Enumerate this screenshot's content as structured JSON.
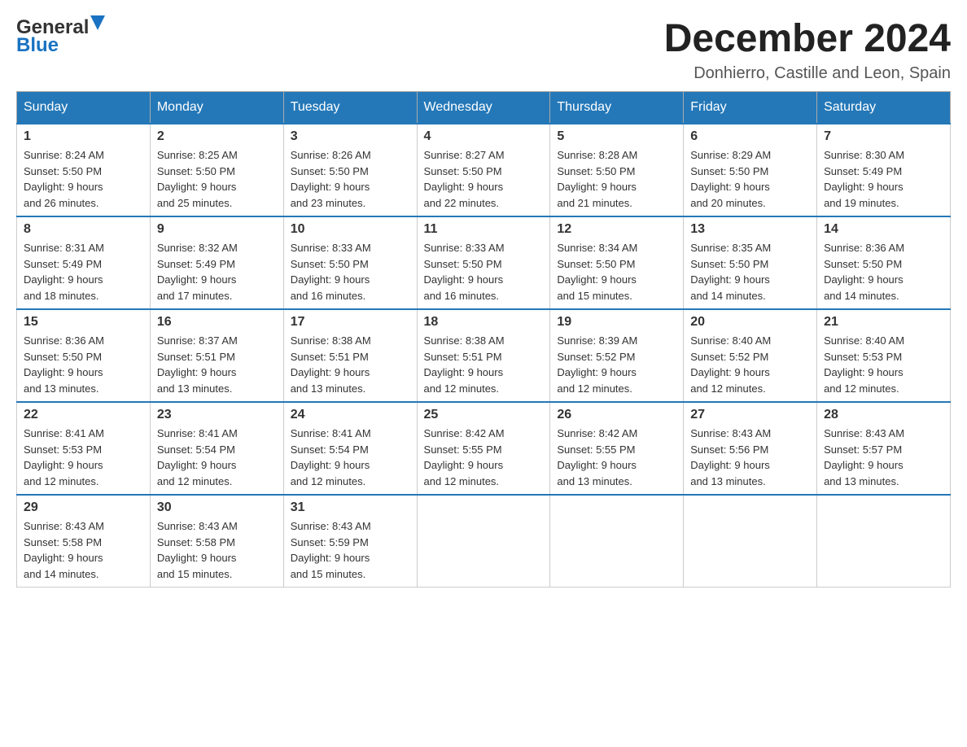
{
  "header": {
    "logo_general": "General",
    "logo_blue": "Blue",
    "month_title": "December 2024",
    "location": "Donhierro, Castille and Leon, Spain"
  },
  "days_of_week": [
    "Sunday",
    "Monday",
    "Tuesday",
    "Wednesday",
    "Thursday",
    "Friday",
    "Saturday"
  ],
  "weeks": [
    [
      {
        "day": "1",
        "sunrise": "8:24 AM",
        "sunset": "5:50 PM",
        "daylight": "9 hours and 26 minutes."
      },
      {
        "day": "2",
        "sunrise": "8:25 AM",
        "sunset": "5:50 PM",
        "daylight": "9 hours and 25 minutes."
      },
      {
        "day": "3",
        "sunrise": "8:26 AM",
        "sunset": "5:50 PM",
        "daylight": "9 hours and 23 minutes."
      },
      {
        "day": "4",
        "sunrise": "8:27 AM",
        "sunset": "5:50 PM",
        "daylight": "9 hours and 22 minutes."
      },
      {
        "day": "5",
        "sunrise": "8:28 AM",
        "sunset": "5:50 PM",
        "daylight": "9 hours and 21 minutes."
      },
      {
        "day": "6",
        "sunrise": "8:29 AM",
        "sunset": "5:50 PM",
        "daylight": "9 hours and 20 minutes."
      },
      {
        "day": "7",
        "sunrise": "8:30 AM",
        "sunset": "5:49 PM",
        "daylight": "9 hours and 19 minutes."
      }
    ],
    [
      {
        "day": "8",
        "sunrise": "8:31 AM",
        "sunset": "5:49 PM",
        "daylight": "9 hours and 18 minutes."
      },
      {
        "day": "9",
        "sunrise": "8:32 AM",
        "sunset": "5:49 PM",
        "daylight": "9 hours and 17 minutes."
      },
      {
        "day": "10",
        "sunrise": "8:33 AM",
        "sunset": "5:50 PM",
        "daylight": "9 hours and 16 minutes."
      },
      {
        "day": "11",
        "sunrise": "8:33 AM",
        "sunset": "5:50 PM",
        "daylight": "9 hours and 16 minutes."
      },
      {
        "day": "12",
        "sunrise": "8:34 AM",
        "sunset": "5:50 PM",
        "daylight": "9 hours and 15 minutes."
      },
      {
        "day": "13",
        "sunrise": "8:35 AM",
        "sunset": "5:50 PM",
        "daylight": "9 hours and 14 minutes."
      },
      {
        "day": "14",
        "sunrise": "8:36 AM",
        "sunset": "5:50 PM",
        "daylight": "9 hours and 14 minutes."
      }
    ],
    [
      {
        "day": "15",
        "sunrise": "8:36 AM",
        "sunset": "5:50 PM",
        "daylight": "9 hours and 13 minutes."
      },
      {
        "day": "16",
        "sunrise": "8:37 AM",
        "sunset": "5:51 PM",
        "daylight": "9 hours and 13 minutes."
      },
      {
        "day": "17",
        "sunrise": "8:38 AM",
        "sunset": "5:51 PM",
        "daylight": "9 hours and 13 minutes."
      },
      {
        "day": "18",
        "sunrise": "8:38 AM",
        "sunset": "5:51 PM",
        "daylight": "9 hours and 12 minutes."
      },
      {
        "day": "19",
        "sunrise": "8:39 AM",
        "sunset": "5:52 PM",
        "daylight": "9 hours and 12 minutes."
      },
      {
        "day": "20",
        "sunrise": "8:40 AM",
        "sunset": "5:52 PM",
        "daylight": "9 hours and 12 minutes."
      },
      {
        "day": "21",
        "sunrise": "8:40 AM",
        "sunset": "5:53 PM",
        "daylight": "9 hours and 12 minutes."
      }
    ],
    [
      {
        "day": "22",
        "sunrise": "8:41 AM",
        "sunset": "5:53 PM",
        "daylight": "9 hours and 12 minutes."
      },
      {
        "day": "23",
        "sunrise": "8:41 AM",
        "sunset": "5:54 PM",
        "daylight": "9 hours and 12 minutes."
      },
      {
        "day": "24",
        "sunrise": "8:41 AM",
        "sunset": "5:54 PM",
        "daylight": "9 hours and 12 minutes."
      },
      {
        "day": "25",
        "sunrise": "8:42 AM",
        "sunset": "5:55 PM",
        "daylight": "9 hours and 12 minutes."
      },
      {
        "day": "26",
        "sunrise": "8:42 AM",
        "sunset": "5:55 PM",
        "daylight": "9 hours and 13 minutes."
      },
      {
        "day": "27",
        "sunrise": "8:43 AM",
        "sunset": "5:56 PM",
        "daylight": "9 hours and 13 minutes."
      },
      {
        "day": "28",
        "sunrise": "8:43 AM",
        "sunset": "5:57 PM",
        "daylight": "9 hours and 13 minutes."
      }
    ],
    [
      {
        "day": "29",
        "sunrise": "8:43 AM",
        "sunset": "5:58 PM",
        "daylight": "9 hours and 14 minutes."
      },
      {
        "day": "30",
        "sunrise": "8:43 AM",
        "sunset": "5:58 PM",
        "daylight": "9 hours and 15 minutes."
      },
      {
        "day": "31",
        "sunrise": "8:43 AM",
        "sunset": "5:59 PM",
        "daylight": "9 hours and 15 minutes."
      },
      null,
      null,
      null,
      null
    ]
  ]
}
